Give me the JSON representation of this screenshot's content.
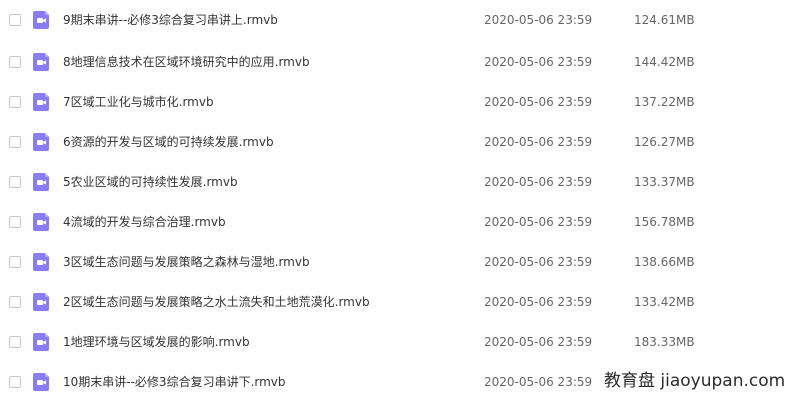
{
  "icon": {
    "name": "video-file-icon",
    "color": "#8a7cf6"
  },
  "files": [
    {
      "name": "9期末串讲--必修3综合复习串讲上.rmvb",
      "date": "2020-05-06 23:59",
      "size": "124.61MB"
    },
    {
      "name": "8地理信息技术在区域环境研究中的应用.rmvb",
      "date": "2020-05-06 23:59",
      "size": "144.42MB"
    },
    {
      "name": "7区域工业化与城市化.rmvb",
      "date": "2020-05-06 23:59",
      "size": "137.22MB"
    },
    {
      "name": "6资源的开发与区域的可持续发展.rmvb",
      "date": "2020-05-06 23:59",
      "size": "126.27MB"
    },
    {
      "name": "5农业区域的可持续性发展.rmvb",
      "date": "2020-05-06 23:59",
      "size": "133.37MB"
    },
    {
      "name": "4流域的开发与综合治理.rmvb",
      "date": "2020-05-06 23:59",
      "size": "156.78MB"
    },
    {
      "name": "3区域生态问题与发展策略之森林与湿地.rmvb",
      "date": "2020-05-06 23:59",
      "size": "138.66MB"
    },
    {
      "name": "2区域生态问题与发展策略之水土流失和土地荒漠化.rmvb",
      "date": "2020-05-06 23:59",
      "size": "133.42MB"
    },
    {
      "name": "1地理环境与区域发展的影响.rmvb",
      "date": "2020-05-06 23:59",
      "size": "183.33MB"
    },
    {
      "name": "10期末串讲--必修3综合复习串讲下.rmvb",
      "date": "2020-05-06 23:59",
      "size": ""
    }
  ],
  "watermark": {
    "text": "教育盘 jiaoyupan.com"
  }
}
